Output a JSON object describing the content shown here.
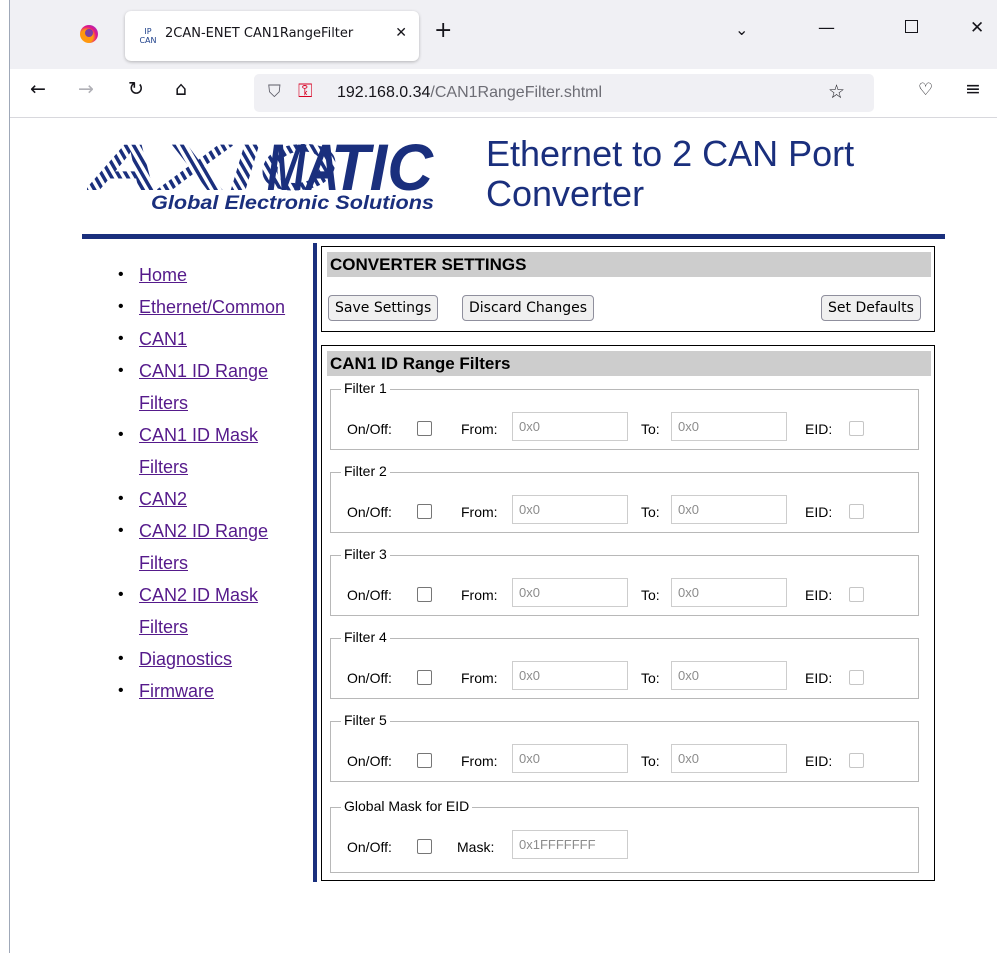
{
  "browser": {
    "tab_title": "2CAN-ENET CAN1RangeFilter",
    "tab_icon_label": "IP CAN",
    "url_host": "192.168.0.34",
    "url_path": "/CAN1RangeFilter.shtml",
    "icons": [
      "firefox-icon",
      "close-icon",
      "plus-icon",
      "chevron-down-icon",
      "minimize-icon",
      "maximize-icon",
      "close-window-icon",
      "back-icon",
      "forward-icon",
      "reload-icon",
      "home-icon",
      "shield-icon",
      "insecure-lock-icon",
      "star-icon",
      "pocket-icon",
      "menu-icon"
    ]
  },
  "header": {
    "logo_text": "AXIOMATIC",
    "logo_tagline": "Global Electronic Solutions",
    "title": "Ethernet to 2 CAN Port Converter",
    "accent_color": "#1a2f7d"
  },
  "nav": {
    "items": [
      {
        "label": "Home"
      },
      {
        "label": "Ethernet/Common"
      },
      {
        "label": "CAN1"
      },
      {
        "label": "CAN1 ID Range Filters"
      },
      {
        "label": "CAN1 ID Mask Filters"
      },
      {
        "label": "CAN2"
      },
      {
        "label": "CAN2 ID Range Filters"
      },
      {
        "label": "CAN2 ID Mask Filters"
      },
      {
        "label": "Diagnostics"
      },
      {
        "label": "Firmware"
      }
    ]
  },
  "converter": {
    "heading": "CONVERTER SETTINGS",
    "save_label": "Save Settings",
    "discard_label": "Discard Changes",
    "defaults_label": "Set Defaults"
  },
  "filters": {
    "heading": "CAN1 ID Range Filters",
    "onoff_label": "On/Off:",
    "from_label": "From:",
    "to_label": "To:",
    "eid_label": "EID:",
    "items": [
      {
        "legend": "Filter 1",
        "from": "0x0",
        "to": "0x0"
      },
      {
        "legend": "Filter 2",
        "from": "0x0",
        "to": "0x0"
      },
      {
        "legend": "Filter 3",
        "from": "0x0",
        "to": "0x0"
      },
      {
        "legend": "Filter 4",
        "from": "0x0",
        "to": "0x0"
      },
      {
        "legend": "Filter 5",
        "from": "0x0",
        "to": "0x0"
      }
    ],
    "global": {
      "legend": "Global Mask for EID",
      "mask_label": "Mask:",
      "mask": "0x1FFFFFFF"
    }
  }
}
